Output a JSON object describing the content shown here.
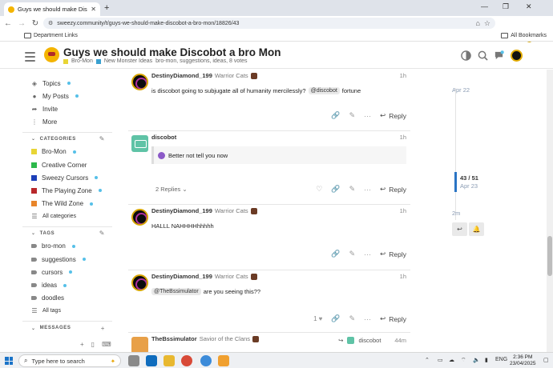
{
  "browser": {
    "tab_title": "Guys we should make Discobot a bro",
    "url": "sweezy.community/t/guys-we-should-make-discobot-a-bro-mon/18826/43",
    "bookmark_folder": "Department Links",
    "all_bookmarks": "All Bookmarks"
  },
  "header": {
    "title": "Guys we should make Discobot a bro Mon",
    "category": "Bro-Mon",
    "subcategory": "New Monster Ideas",
    "tags": "bro-mon, suggestions, ideas, 8 votes",
    "colors": {
      "bro_mon": "#e8d535",
      "new_monster_ideas": "#3aa0d0"
    }
  },
  "sidebar": {
    "nav": [
      {
        "label": "Topics",
        "icon": "layers-icon",
        "dot": true
      },
      {
        "label": "My Posts",
        "icon": "user-icon",
        "dot": true
      },
      {
        "label": "Invite",
        "icon": "share-icon",
        "dot": false
      },
      {
        "label": "More",
        "icon": "more-icon",
        "dot": false
      }
    ],
    "categories_heading": "CATEGORIES",
    "categories": [
      {
        "label": "Bro-Mon",
        "color": "#e8d535",
        "dot": true
      },
      {
        "label": "Creative Corner",
        "color": "#2db84b",
        "dot": false
      },
      {
        "label": "Sweezy Cursors",
        "color": "#1c3fb8",
        "dot": true
      },
      {
        "label": "The Playing Zone",
        "color": "#b8282b",
        "dot": true
      },
      {
        "label": "The Wild Zone",
        "color": "#e8852a",
        "dot": true
      }
    ],
    "all_categories": "All categories",
    "tags_heading": "TAGS",
    "tags": [
      {
        "label": "bro-mon",
        "dot": true
      },
      {
        "label": "suggestions",
        "dot": true
      },
      {
        "label": "cursors",
        "dot": true
      },
      {
        "label": "ideas",
        "dot": true
      },
      {
        "label": "doodles",
        "dot": false
      }
    ],
    "all_tags": "All tags",
    "messages_heading": "MESSAGES"
  },
  "posts": [
    {
      "username": "DestinyDiamond_199",
      "user_title": "Warrior Cats",
      "time": "1h",
      "text_before": "is discobot going to subjugate all of humanity mercilessly?",
      "mention": "@discobot",
      "text_after": "fortune",
      "reply_label": "Reply"
    },
    {
      "username": "discobot",
      "time": "1h",
      "quote": "Better not tell you now",
      "replies": "2 Replies",
      "reply_label": "Reply"
    },
    {
      "username": "DestinyDiamond_199",
      "user_title": "Warrior Cats",
      "time": "1h",
      "text": "HALLL NAHHHHhhhhh",
      "reply_label": "Reply"
    },
    {
      "username": "DestinyDiamond_199",
      "user_title": "Warrior Cats",
      "time": "1h",
      "mention": "@TheBssimulator",
      "text_after": "are you seeing this??",
      "likes": "1",
      "reply_label": "Reply"
    },
    {
      "username": "TheBssimulator",
      "user_title": "Savior of the Clans",
      "reply_to": "discobot",
      "time": "44m"
    }
  ],
  "timeline": {
    "top_date": "Apr 22",
    "position": "43 / 51",
    "position_date": "Apr 23",
    "bottom": "2m"
  },
  "taskbar": {
    "search_placeholder": "Type here to search",
    "lang": "ENG",
    "time": "2:36 PM",
    "date": "23/04/2025"
  }
}
